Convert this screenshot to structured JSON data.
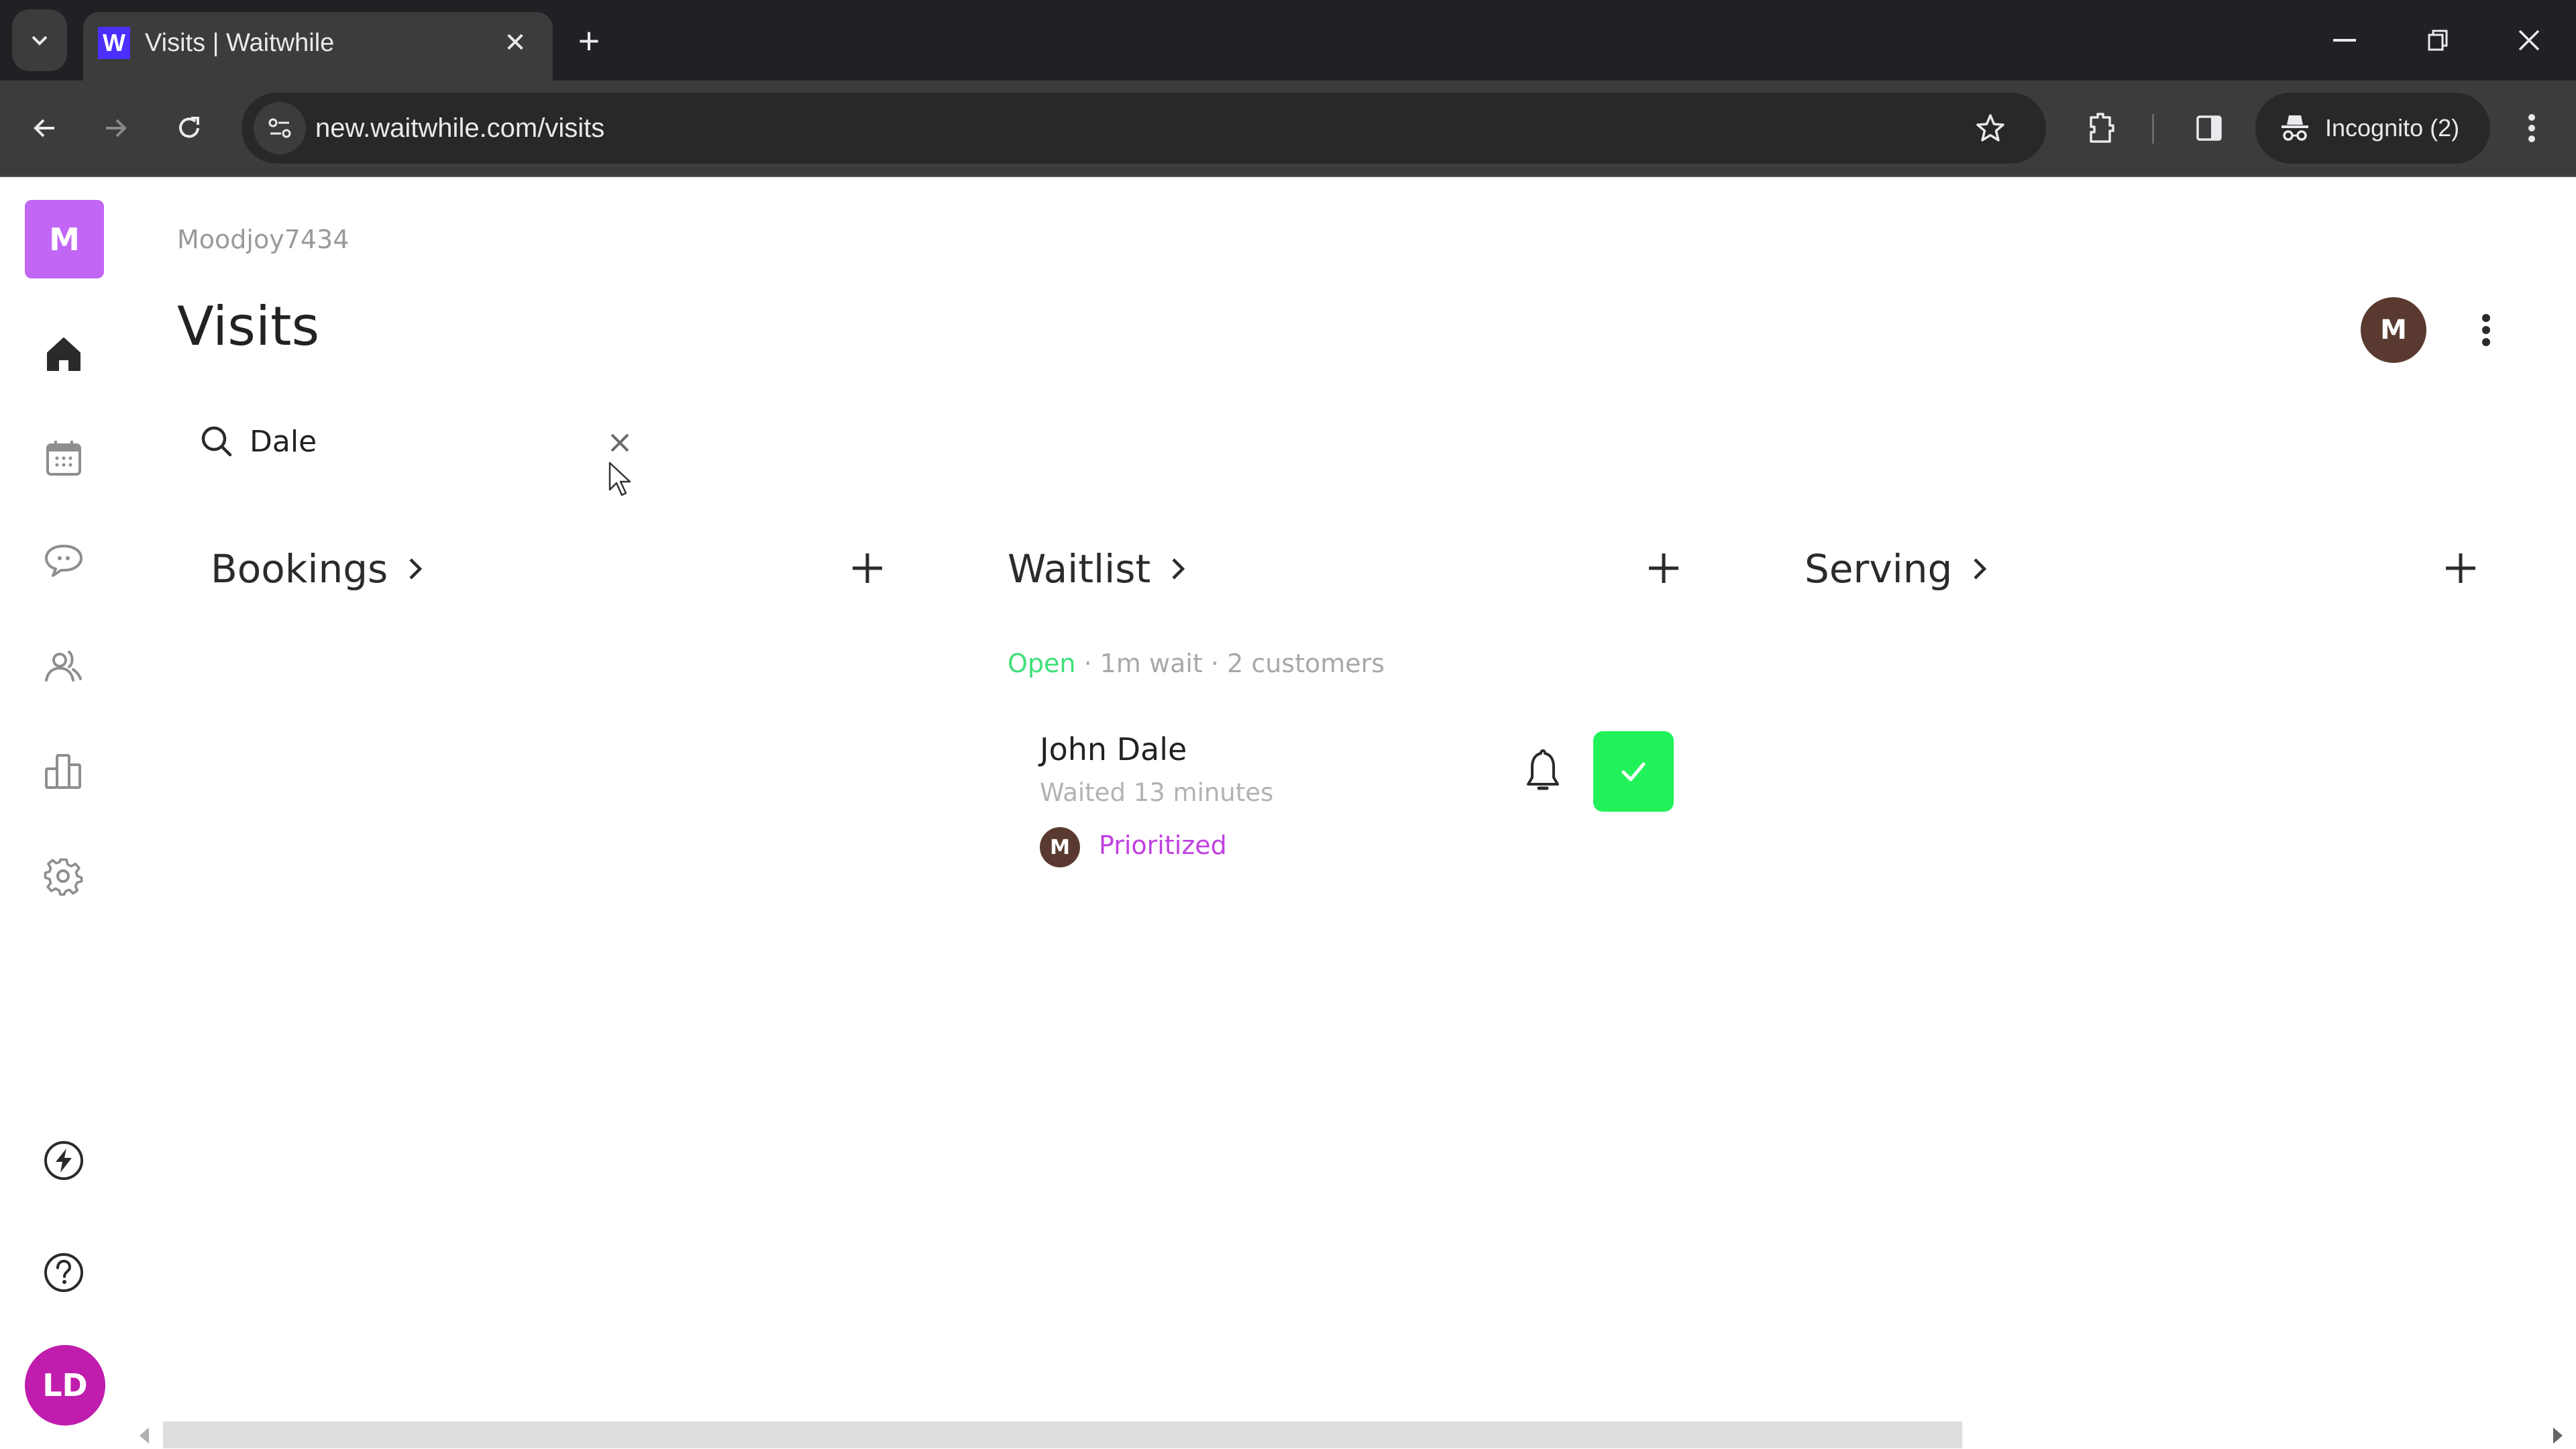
{
  "browser": {
    "tab_title": "Visits | Waitwhile",
    "favicon_letter": "W",
    "url": "new.waitwhile.com/visits",
    "incognito_label": "Incognito (2)",
    "tab_close": "✕",
    "new_tab": "+",
    "window_minimize": "–",
    "window_close": "✕"
  },
  "sidebar": {
    "logo_letter": "M",
    "logo_color": "#c266f5",
    "items": [
      {
        "name": "home",
        "active": true
      },
      {
        "name": "calendar",
        "active": false
      },
      {
        "name": "messages",
        "active": false
      },
      {
        "name": "customers",
        "active": false
      },
      {
        "name": "analytics",
        "active": false
      },
      {
        "name": "settings",
        "active": false
      }
    ],
    "bottom_items": [
      {
        "name": "whats-new"
      },
      {
        "name": "help"
      }
    ],
    "user_initials": "LD",
    "user_color": "#c01cad"
  },
  "header": {
    "org_name": "Moodjoy7434",
    "title": "Visits",
    "avatar_letter": "M",
    "avatar_color": "#5a3a30"
  },
  "search": {
    "value": "Dale",
    "placeholder": "Search"
  },
  "columns": [
    {
      "title": "Bookings"
    },
    {
      "title": "Waitlist"
    },
    {
      "title": "Serving"
    }
  ],
  "waitlist": {
    "status": "Open",
    "status_color": "#3ee07a",
    "details": " · 1m wait · 2 customers",
    "visitors": [
      {
        "name": "John Dale",
        "wait_text": "Waited 13 minutes",
        "avatar_letter": "M",
        "tag": "Prioritized",
        "tag_color": "#c040e0"
      }
    ]
  },
  "colors": {
    "serve_button": "#22f25a"
  }
}
